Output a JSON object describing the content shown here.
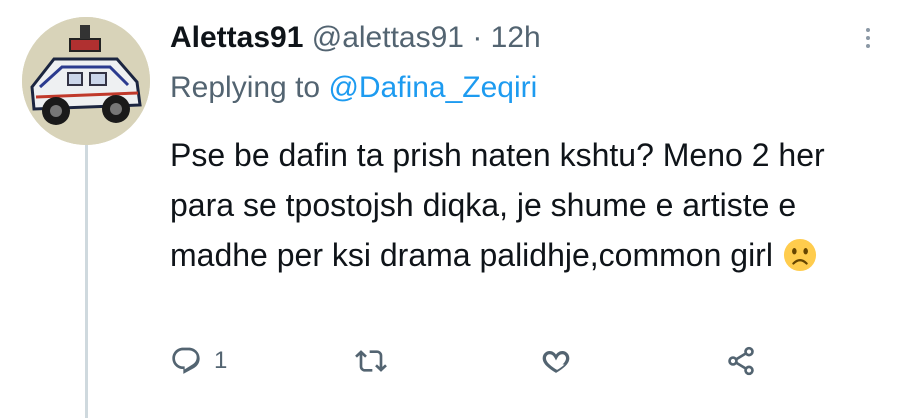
{
  "tweet": {
    "display_name": "Alettas91",
    "handle": "@alettas91",
    "separator": "·",
    "time": "12h",
    "replying_prefix": "Replying to",
    "replying_to": "@Dafina_Zeqiri",
    "body": "Pse be dafin ta prish naten kshtu? Meno 2 her para se tpostojsh diqka, je shume e artiste e madhe per ksi drama palidhje,common girl",
    "emoji": "sad-face-emoji"
  },
  "actions": {
    "reply_count": "1",
    "icons": [
      "reply-icon",
      "retweet-icon",
      "like-icon",
      "share-icon"
    ]
  },
  "colors": {
    "text": "#0f1419",
    "secondary": "#536471",
    "accent": "#1d9bf0",
    "thread_line": "#cfd9de"
  }
}
